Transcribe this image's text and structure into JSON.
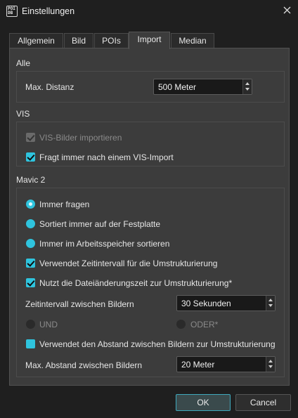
{
  "window": {
    "title": "Einstellungen",
    "icon_text": "POI DB"
  },
  "tabs": [
    {
      "label": "Allgemein",
      "active": false
    },
    {
      "label": "Bild",
      "active": false
    },
    {
      "label": "POIs",
      "active": false
    },
    {
      "label": "Import",
      "active": true
    },
    {
      "label": "Median",
      "active": false
    }
  ],
  "alle": {
    "title": "Alle",
    "max_distanz_label": "Max. Distanz",
    "max_distanz_value": "500 Meter"
  },
  "vis": {
    "title": "VIS",
    "import_label": "VIS-Bilder importieren",
    "import_checked": true,
    "import_enabled": false,
    "ask_label": "Fragt immer nach einem VIS-Import",
    "ask_checked": true
  },
  "mavic": {
    "title": "Mavic 2",
    "radio_ask": "Immer fragen",
    "radio_disk": "Sortiert  immer auf der Festplatte",
    "radio_memory": "Immer im Arbeitsspeicher sortieren",
    "selected_radio": "ask",
    "cb_interval": "Verwendet Zeitintervall für die Umstrukturierung",
    "cb_interval_checked": true,
    "cb_filetime": "Nutzt die Dateiänderungszeit zur Umstrukturierung*",
    "cb_filetime_checked": true,
    "interval_label": "Zeitintervall zwischen Bildern",
    "interval_value": "30 Sekunden",
    "und_label": "UND",
    "oder_label": "ODER*",
    "cb_distance": "Verwendet den Abstand zwischen Bildern zur Umstrukturierung",
    "cb_distance_checked": false,
    "max_abstand_label": "Max. Abstand zwischen Bildern",
    "max_abstand_value": "20 Meter"
  },
  "buttons": {
    "ok": "OK",
    "cancel": "Cancel"
  },
  "colors": {
    "accent": "#2fc4de",
    "background": "#1f1f1f",
    "panel": "#3c3c3c"
  },
  "icons": {
    "close": "close-icon",
    "app": "app-icon",
    "spin_up": "arrow-up-icon",
    "spin_down": "arrow-down-icon"
  }
}
